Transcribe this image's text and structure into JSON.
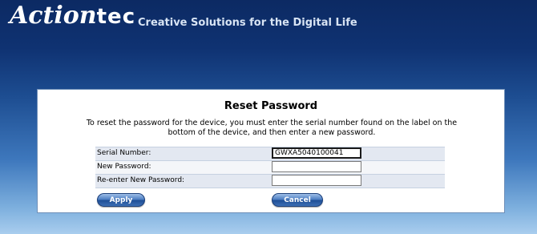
{
  "header": {
    "logo_main": "Action",
    "logo_tec": "tec",
    "tagline": "Creative Solutions for the Digital Life"
  },
  "panel": {
    "title": "Reset Password",
    "description": "To reset the password for the device, you must enter the serial number found on the label on the bottom of the device, and then enter a new password."
  },
  "form": {
    "serial_label": "Serial Number:",
    "serial_value": "GWXA5040100041",
    "new_password_label": "New Password:",
    "new_password_value": "",
    "reenter_label": "Re-enter New Password:",
    "reenter_value": ""
  },
  "buttons": {
    "apply": "Apply",
    "cancel": "Cancel"
  }
}
